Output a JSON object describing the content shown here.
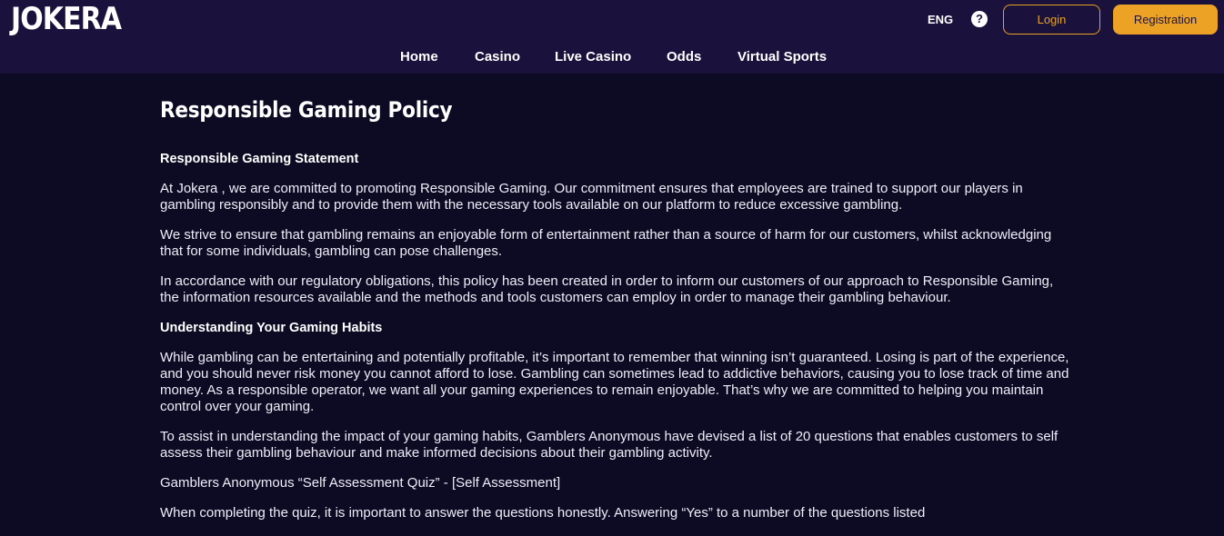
{
  "header": {
    "logo": "JOKERA",
    "language": "ENG",
    "help_symbol": "?",
    "login_label": "Login",
    "registration_label": "Registration"
  },
  "nav": [
    {
      "label": "Home"
    },
    {
      "label": "Casino"
    },
    {
      "label": "Live Casino"
    },
    {
      "label": "Odds"
    },
    {
      "label": "Virtual Sports"
    }
  ],
  "page": {
    "title": "Responsible Gaming Policy",
    "sections": {
      "s1_heading": "Responsible Gaming Statement",
      "p1": "At Jokera , we are committed to promoting Responsible Gaming. Our commitment ensures that employees are trained to support our players in gambling responsibly and to provide them with the necessary tools available on our platform to reduce excessive gambling.",
      "p2": "We strive to ensure that gambling remains an enjoyable form of entertainment rather than a source of harm for our customers, whilst acknowledging that for some individuals, gambling can pose challenges.",
      "p3": "In accordance with our regulatory obligations, this policy has been created in order to inform our customers of our approach to Responsible Gaming, the information resources available and the methods and tools customers can employ in order to manage their gambling behaviour.",
      "s2_heading": "Understanding Your Gaming Habits",
      "p4": "While gambling can be entertaining and potentially profitable, it’s important to remember that winning isn’t guaranteed. Losing is part of the experience, and you should never risk money you cannot afford to lose. Gambling can sometimes lead to addictive behaviors, causing you to lose track of time and money. As a responsible operator, we want all your gaming experiences to remain enjoyable. That’s why we are committed to helping you maintain control over your gaming.",
      "p5": "To assist in understanding the impact of your gaming habits, Gamblers Anonymous have devised a list of 20 questions that enables customers to self assess their gambling behaviour and make informed decisions about their gambling activity.",
      "p6": "Gamblers Anonymous “Self Assessment Quiz” - [Self Assessment]",
      "p7": "When completing the quiz, it is important to answer the questions honestly. Answering “Yes” to a number of the questions listed"
    }
  },
  "colors": {
    "header_bg": "#1a113d",
    "page_bg": "#0d0a24",
    "accent": "#eca325"
  }
}
